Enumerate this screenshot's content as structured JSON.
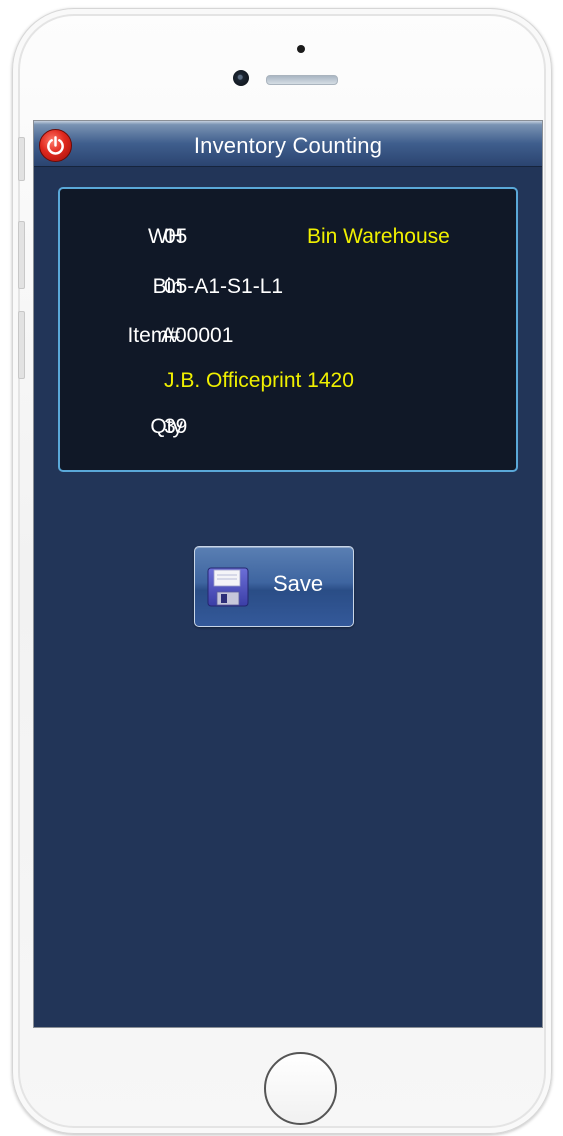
{
  "app": {
    "title": "Inventory Counting"
  },
  "record": {
    "wh_label": "WH",
    "wh_value": "05",
    "wh_name": "Bin Warehouse",
    "bin_label": "Bin",
    "bin_value": "05-A1-S1-L1",
    "item_label": "Item#",
    "item_value": "A00001",
    "item_description": "J.B. Officeprint 1420",
    "qty_label": "Qty",
    "qty_value": "39"
  },
  "actions": {
    "save_label": "Save"
  },
  "icons": {
    "power": "power-icon",
    "save": "floppy-disk-icon"
  },
  "colors": {
    "screen_background": "#223558",
    "panel_background": "#101827",
    "panel_border": "#5aa8d8",
    "highlight_text": "#f0f000",
    "power_button": "#e0281e"
  }
}
